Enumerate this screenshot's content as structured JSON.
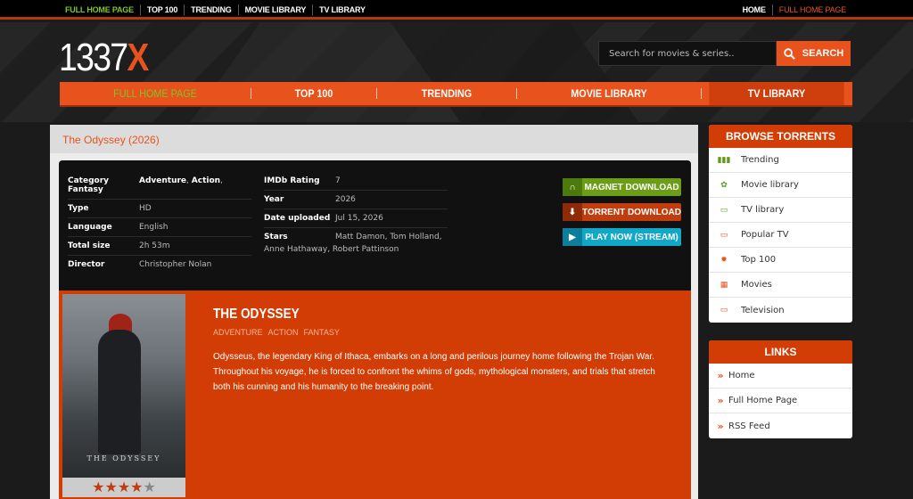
{
  "topbar": {
    "left": [
      "FULL HOME PAGE",
      "TOP 100",
      "TRENDING",
      "MOVIE LIBRARY",
      "TV LIBRARY"
    ],
    "right": [
      "HOME",
      "FULL HOME PAGE"
    ]
  },
  "logo": {
    "text": "1337",
    "accent": "X"
  },
  "search": {
    "placeholder": "Search for movies & series..",
    "button": "SEARCH"
  },
  "nav": [
    "FULL HOME PAGE",
    "TOP 100",
    "TRENDING",
    "MOVIE LIBRARY",
    "TV LIBRARY"
  ],
  "page": {
    "title": "The Odyssey (2026)"
  },
  "info": {
    "category_label": "Category",
    "category_value1": "Adventure",
    "category_value2": "Action",
    "category_value3": "Fantasy",
    "type_label": "Type",
    "type_value": "HD",
    "language_label": "Language",
    "language_value": "English",
    "size_label": "Total size",
    "size_value": "2h 53m",
    "director_label": "Director",
    "director_value": "Christopher Nolan",
    "imdb_label": "IMDb Rating",
    "imdb_value": "7",
    "year_label": "Year",
    "year_value": "2026",
    "uploaded_label": "Date uploaded",
    "uploaded_value": "Jul 15, 2026",
    "stars_label": "Stars",
    "stars_value1": "Matt Damon, Tom Holland,",
    "stars_value2": "Anne Hathaway, Robert Pattinson"
  },
  "buttons": {
    "magnet": "MAGNET DOWNLOAD",
    "torrent": "TORRENT DOWNLOAD",
    "stream": "PLAY NOW (STREAM)"
  },
  "movie": {
    "title": "THE ODYSSEY",
    "genres": [
      "ADVENTURE",
      "ACTION",
      "FANTASY"
    ],
    "description": "Odysseus, the legendary King of Ithaca, embarks on a long and perilous journey home following the Trojan War. Throughout his voyage, he is forced to confront the whims of gods, mythological monsters, and trials that stretch both his cunning and his humanity to the breaking point.",
    "poster_text": "THE ODYSSEY",
    "rating_stars": 4,
    "rating_max": 5
  },
  "sidebar": {
    "browse_title": "BROWSE TORRENTS",
    "browse": [
      {
        "label": "Trending",
        "icon": "trending-icon"
      },
      {
        "label": "Movie library",
        "icon": "film-reel-icon"
      },
      {
        "label": "TV library",
        "icon": "tv-icon"
      },
      {
        "label": "Popular TV",
        "icon": "tv-icon"
      },
      {
        "label": "Top 100",
        "icon": "top-badge-icon"
      },
      {
        "label": "Movies",
        "icon": "clapper-icon"
      },
      {
        "label": "Television",
        "icon": "tv-icon"
      }
    ],
    "links_title": "LINKS",
    "links": [
      "Home",
      "Full Home Page",
      "RSS Feed"
    ]
  },
  "colors": {
    "accent": "#e8521d",
    "green": "#7fc428",
    "magnet": "#6c9d16",
    "stream": "#11a7c9"
  }
}
